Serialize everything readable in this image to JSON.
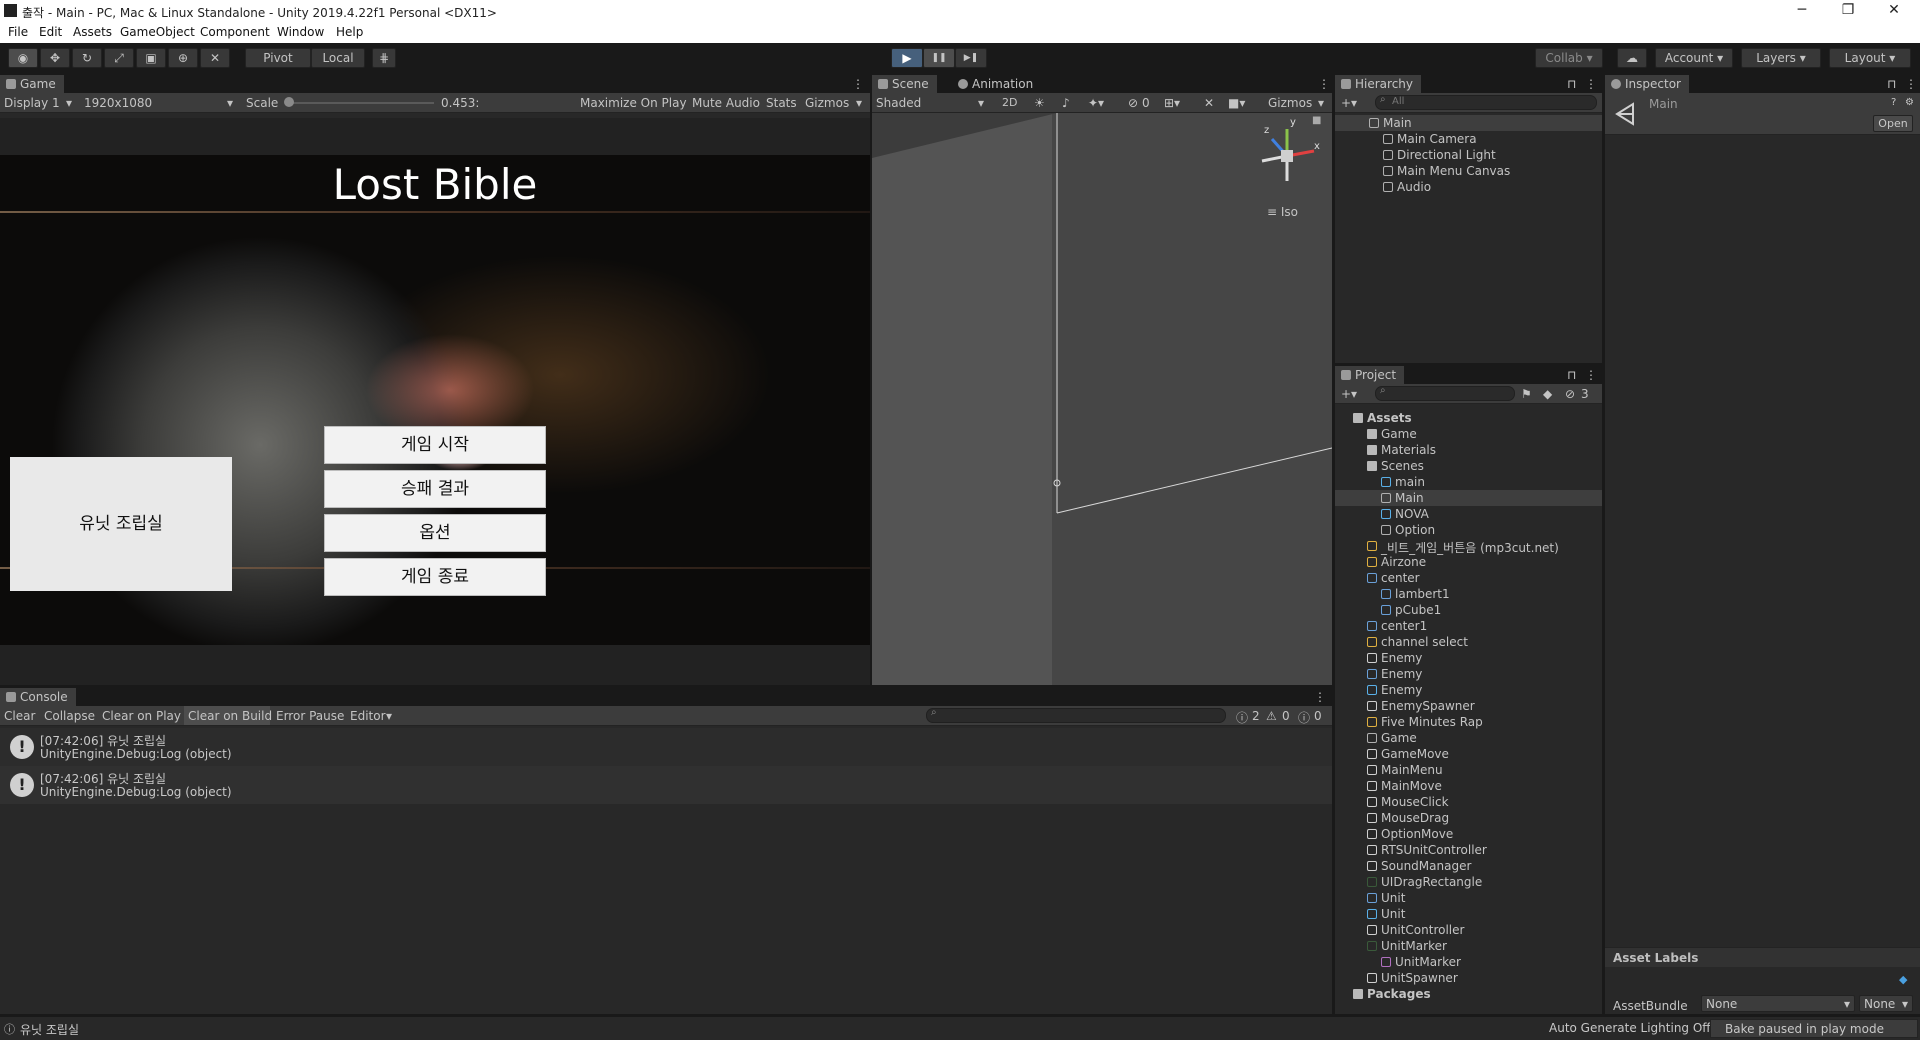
{
  "window": {
    "title": "출작 - Main - PC, Mac & Linux Standalone - Unity 2019.4.22f1 Personal <DX11>",
    "minimize": "─",
    "restore": "❐",
    "close": "✕"
  },
  "menu": [
    "File",
    "Edit",
    "Assets",
    "GameObject",
    "Component",
    "Window",
    "Help"
  ],
  "toolbar": {
    "pivot": "Pivot",
    "local": "Local",
    "collab": "Collab",
    "account": "Account",
    "layers": "Layers",
    "layout": "Layout",
    "play_icon": "▶",
    "pause_icon": "❚❚",
    "step_icon": "▶❚"
  },
  "game_view": {
    "tab": "Game",
    "display": "Display 1",
    "resolution": "1920x1080",
    "scale_label": "Scale",
    "scale_value": "0.453:",
    "maximize": "Maximize On Play",
    "mute": "Mute Audio",
    "stats": "Stats",
    "gizmos": "Gizmos",
    "title": "Lost Bible",
    "buttons": [
      "게임 시작",
      "승패 결과",
      "옵션",
      "게임 종료"
    ],
    "side_button": "유닛 조립실"
  },
  "scene_view": {
    "tab_scene": "Scene",
    "tab_animation": "Animation",
    "shading": "Shaded",
    "mode_2d": "2D",
    "hidden_count": "0",
    "gizmos": "Gizmos",
    "iso": "Iso",
    "axis_x": "x",
    "axis_y": "y",
    "axis_z": "z"
  },
  "hierarchy": {
    "tab": "Hierarchy",
    "search_placeholder": "All",
    "items": [
      {
        "label": "Main",
        "depth": 0,
        "icon": "unity-scene-icon"
      },
      {
        "label": "Main Camera",
        "depth": 1,
        "icon": "gameobject-icon"
      },
      {
        "label": "Directional Light",
        "depth": 1,
        "icon": "gameobject-icon"
      },
      {
        "label": "Main Menu Canvas",
        "depth": 1,
        "icon": "gameobject-icon"
      },
      {
        "label": "Audio",
        "depth": 1,
        "icon": "gameobject-icon"
      }
    ]
  },
  "project": {
    "tab": "Project",
    "hidden_count": "3",
    "items": [
      {
        "label": "Assets",
        "depth": 0,
        "icon": "folder-open-icon"
      },
      {
        "label": "Game",
        "depth": 1,
        "icon": "folder-icon"
      },
      {
        "label": "Materials",
        "depth": 1,
        "icon": "folder-icon"
      },
      {
        "label": "Scenes",
        "depth": 1,
        "icon": "folder-open-icon"
      },
      {
        "label": "main",
        "depth": 2,
        "icon": "prefab-icon"
      },
      {
        "label": "Main",
        "depth": 2,
        "icon": "unity-scene-icon"
      },
      {
        "label": "NOVA",
        "depth": 2,
        "icon": "prefab-icon"
      },
      {
        "label": "Option",
        "depth": 2,
        "icon": "unity-scene-icon"
      },
      {
        "label": "_비트_게임_버튼음 (mp3cut.net)",
        "depth": 1,
        "icon": "audio-icon"
      },
      {
        "label": "Airzone",
        "depth": 1,
        "icon": "audio-icon"
      },
      {
        "label": "center",
        "depth": 1,
        "icon": "model-icon"
      },
      {
        "label": "lambert1",
        "depth": 2,
        "icon": "material-icon"
      },
      {
        "label": "pCube1",
        "depth": 2,
        "icon": "mesh-icon"
      },
      {
        "label": "center1",
        "depth": 1,
        "icon": "material-icon"
      },
      {
        "label": "channel select",
        "depth": 1,
        "icon": "audio-icon"
      },
      {
        "label": "Enemy",
        "depth": 1,
        "icon": "script-icon"
      },
      {
        "label": "Enemy",
        "depth": 1,
        "icon": "material-icon"
      },
      {
        "label": "Enemy",
        "depth": 1,
        "icon": "prefab-icon"
      },
      {
        "label": "EnemySpawner",
        "depth": 1,
        "icon": "script-icon"
      },
      {
        "label": "Five Minutes Rap",
        "depth": 1,
        "icon": "audio-icon"
      },
      {
        "label": "Game",
        "depth": 1,
        "icon": "unity-scene-icon"
      },
      {
        "label": "GameMove",
        "depth": 1,
        "icon": "script-icon"
      },
      {
        "label": "MainMenu",
        "depth": 1,
        "icon": "script-icon"
      },
      {
        "label": "MainMove",
        "depth": 1,
        "icon": "script-icon"
      },
      {
        "label": "MouseClick",
        "depth": 1,
        "icon": "script-icon"
      },
      {
        "label": "MouseDrag",
        "depth": 1,
        "icon": "script-icon"
      },
      {
        "label": "OptionMove",
        "depth": 1,
        "icon": "script-icon"
      },
      {
        "label": "RTSUnitController",
        "depth": 1,
        "icon": "script-icon"
      },
      {
        "label": "SoundManager",
        "depth": 1,
        "icon": "script-icon"
      },
      {
        "label": "UIDragRectangle",
        "depth": 1,
        "icon": "texture-icon"
      },
      {
        "label": "Unit",
        "depth": 1,
        "icon": "material-icon"
      },
      {
        "label": "Unit",
        "depth": 1,
        "icon": "prefab-icon"
      },
      {
        "label": "UnitController",
        "depth": 1,
        "icon": "script-icon"
      },
      {
        "label": "UnitMarker",
        "depth": 1,
        "icon": "texture-icon"
      },
      {
        "label": "UnitMarker",
        "depth": 2,
        "icon": "sprite-icon"
      },
      {
        "label": "UnitSpawner",
        "depth": 1,
        "icon": "script-icon"
      },
      {
        "label": "Packages",
        "depth": 0,
        "icon": "folder-icon"
      }
    ]
  },
  "inspector": {
    "tab": "Inspector",
    "object": "Main",
    "open": "Open",
    "asset_labels": "Asset Labels",
    "asset_bundle": "AssetBundle",
    "bundle_value": "None",
    "variant_value": "None"
  },
  "console": {
    "tab": "Console",
    "buttons": [
      "Clear",
      "Collapse",
      "Clear on Play",
      "Clear on Build",
      "Error Pause",
      "Editor"
    ],
    "log_count": "2",
    "warn_count": "0",
    "error_count": "0",
    "entries": [
      {
        "line1": "[07:42:06] 유닛 조립실",
        "line2": "UnityEngine.Debug:Log (object)"
      },
      {
        "line1": "[07:42:06] 유닛 조립실",
        "line2": "UnityEngine.Debug:Log (object)"
      }
    ]
  },
  "status": {
    "message": "유닛 조립실",
    "lighting": "Auto Generate Lighting Off",
    "bake": "Bake paused in play mode"
  }
}
